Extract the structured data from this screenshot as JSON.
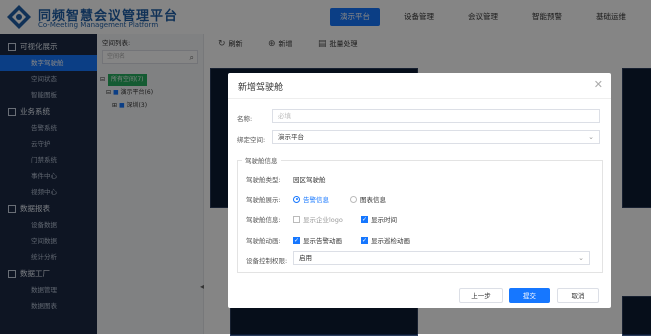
{
  "brand": {
    "title": "同频智慧会议管理平台",
    "subtitle": "Co-Meeting Management Platform"
  },
  "topnav": {
    "tabs": [
      "演示平台",
      "设备管理",
      "会议管理",
      "智能预警",
      "基础运维"
    ],
    "active": "演示平台"
  },
  "sidebar": {
    "groups": [
      {
        "label": "可视化展示",
        "items": [
          "数字驾驶舱",
          "空间状态",
          "智能图板"
        ]
      },
      {
        "label": "业务系统",
        "items": [
          "告警系统",
          "云守护",
          "门禁系统",
          "事件中心",
          "视频中心"
        ]
      },
      {
        "label": "数据报表",
        "items": [
          "设备数据",
          "空间数据",
          "统计分析"
        ]
      },
      {
        "label": "数据工厂",
        "items": [
          "数据管理",
          "数据图表"
        ]
      }
    ],
    "active_item": "数字驾驶舱"
  },
  "tree": {
    "title": "空间列表:",
    "search_placeholder": "空间名",
    "nodes": [
      "所有空间(7)",
      "演示平台(6)",
      "深圳(3)"
    ]
  },
  "toolbar": {
    "refresh": "刷新",
    "add": "新增",
    "batch": "批量处理"
  },
  "modal": {
    "title": "新增驾驶舱",
    "name_label": "名称:",
    "name_placeholder": "必填",
    "space_label": "绑定空间:",
    "space_value": "演示平台",
    "section_title": "驾驶舱信息",
    "type_label": "驾驶舱类型:",
    "type_value": "园区驾驶舱",
    "display_label": "驾驶舱展示:",
    "display_options": [
      "告警信息",
      "图表信息"
    ],
    "display_selected": "告警信息",
    "info_label": "驾驶舱信息:",
    "info_options": [
      {
        "label": "显示企业logo",
        "checked": false
      },
      {
        "label": "显示时间",
        "checked": true
      }
    ],
    "anim_label": "驾驶舱动画:",
    "anim_options": [
      {
        "label": "显示告警动画",
        "checked": true
      },
      {
        "label": "显示巡检动画",
        "checked": true
      }
    ],
    "control_label": "设备控制权限:",
    "control_value": "启用",
    "buttons": {
      "prev": "上一步",
      "submit": "提交",
      "cancel": "取消"
    }
  },
  "colors": {
    "primary": "#1677ff",
    "sidebar_bg": "#1b2a44",
    "tree_selected": "#27ae60"
  }
}
